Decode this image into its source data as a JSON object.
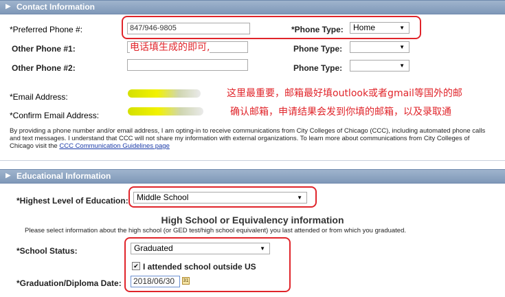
{
  "contact": {
    "title": "Contact Information",
    "preferred_phone_label": "*Preferred Phone #:",
    "preferred_phone_value": "847/946-9805",
    "phone_type_label_star": "*Phone Type:",
    "phone_type_value": "Home",
    "other_phone1_label": "Other Phone #1:",
    "other_phone2_label": "Other Phone #2:",
    "phone_type_label": "Phone Type:",
    "email_label": "*Email Address:",
    "confirm_email_label": "*Confirm Email Address:",
    "notice_text": "By providing a phone number and/or email address, I am opting-in to receive communications from City Colleges of Chicago (CCC), including automated phone calls and text messages. I understand that CCC will not share my information with external organizations. To learn more about communications from City Colleges of Chicago visit the ",
    "notice_link": "CCC Communication Guidelines page"
  },
  "annotations": {
    "phone_note": "电话填生成的即可,",
    "email_note": "这里最重要，邮箱最好填outlook或者gmail等国外的邮",
    "confirm_note": "确认邮箱，申请结果会发到你填的邮箱，以及录取通"
  },
  "education": {
    "title": "Educational Information",
    "highest_level_label": "*Highest Level of Education:",
    "highest_level_value": "Middle School",
    "hs_title": "High School or Equivalency information",
    "hs_instruction": "Please select information about the high school (or GED test/high school equivalent) you last attended or from which you graduated.",
    "school_status_label": "*School Status:",
    "school_status_value": "Graduated",
    "outside_us_label": "I attended school outside US",
    "outside_us_checked": true,
    "grad_date_label": "*Graduation/Diploma Date:",
    "grad_date_value": "2018/06/30"
  },
  "icons": {
    "section_toggle": "triangle-right-icon",
    "calendar": "calendar-icon",
    "dropdown": "chevron-down-icon",
    "checkbox": "checkmark-icon"
  },
  "colors": {
    "section_bar": "#8ca3c1",
    "annotation_red": "#e0242a",
    "link": "#1a3aa8"
  }
}
